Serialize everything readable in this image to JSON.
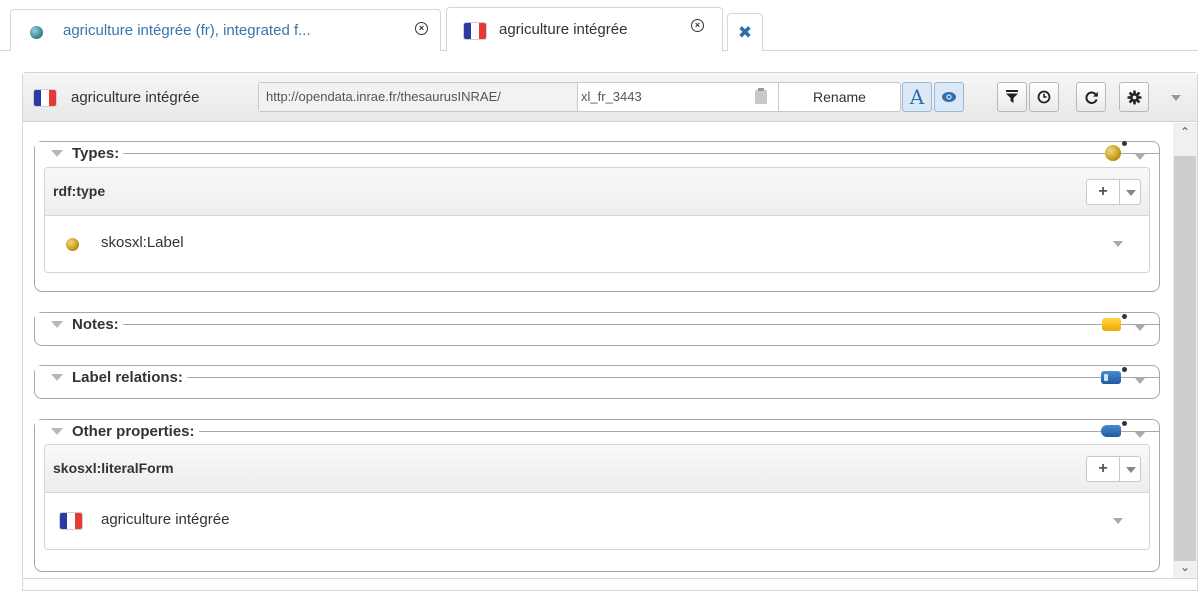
{
  "tabs": [
    {
      "label": "agriculture intégrée (fr), integrated f...",
      "icon": "sphere-icon"
    },
    {
      "label": "agriculture intégrée",
      "icon": "flag-fr-icon"
    },
    {
      "icon": "close-x-icon"
    }
  ],
  "header": {
    "title": "agriculture intégrée",
    "uri_namespace": "http://opendata.inrae.fr/thesaurusINRAE/",
    "uri_localname": "xl_fr_3443",
    "rename_label": "Rename",
    "toolbar_icons": [
      "rendering-a-icon",
      "eye-icon",
      "filter-icon",
      "history-icon",
      "refresh-icon",
      "gear-icon"
    ]
  },
  "sections": [
    {
      "title": "Types:",
      "icon": "resource-ball-icon",
      "property": "rdf:type",
      "values": [
        {
          "text": "skosxl:Label",
          "icon": "resource-ball-icon"
        }
      ]
    },
    {
      "title": "Notes:",
      "icon": "note-icon"
    },
    {
      "title": "Label relations:",
      "icon": "label-relation-icon"
    },
    {
      "title": "Other properties:",
      "icon": "property-icon",
      "property": "skosxl:literalForm",
      "values": [
        {
          "text": "agriculture intégrée",
          "icon": "flag-fr-icon"
        }
      ]
    }
  ],
  "colors": {
    "link_blue": "#3874ad",
    "flag_blue": "#2b3ba6",
    "flag_red": "#e53935",
    "resource_gold": "#c59a18",
    "note_yellow": "#f0a800",
    "relation_blue": "#1f5a9e"
  }
}
